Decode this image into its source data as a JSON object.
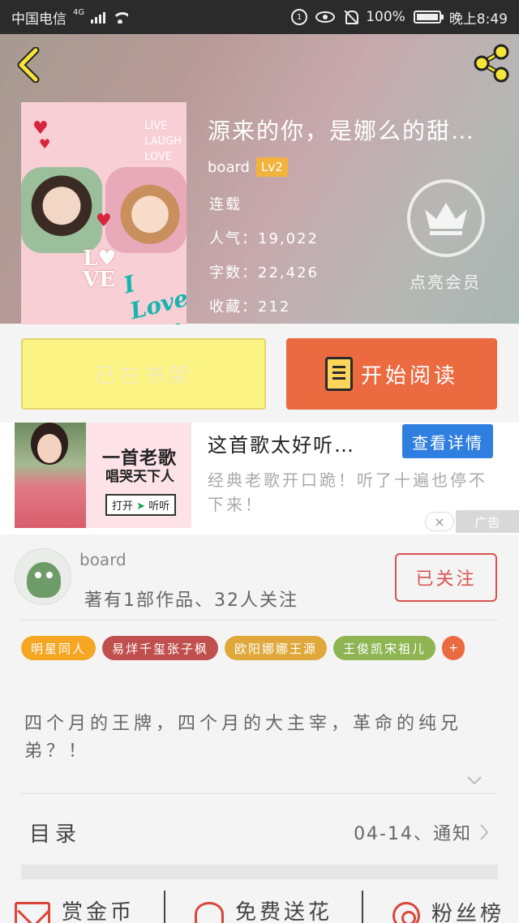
{
  "status_bar": {
    "carrier": "中国电信",
    "network": "4G",
    "do_not_disturb_icon": "1",
    "battery": "100%",
    "time": "晚上8:49"
  },
  "header": {
    "back_icon": "chevron-left-icon",
    "share_icon": "share-icon"
  },
  "book": {
    "title": "源来的你，是娜么的甜…",
    "author": "board",
    "level": "Lv2",
    "status": "连载",
    "popularity": "人气：19,022",
    "word_count": "字数：22,426",
    "favorites": "收藏：212",
    "cover": {
      "live_text": "LIVE\nLAUGH\nLOVE",
      "love_text": "L♥\nVE",
      "i_love_you": "I Love You"
    }
  },
  "vip": {
    "label": "点亮会员",
    "icon": "crown-icon"
  },
  "actions": {
    "shelf_label": "已在书架",
    "read_label": "开始阅读"
  },
  "ad": {
    "image_line1": "一首老歌",
    "image_line2": "唱哭天下人",
    "image_cta_open": "打开",
    "image_cta_listen": "听听",
    "title": "这首歌太好听…",
    "button": "查看详情",
    "description": "经典老歌开口跪！听了十遍也停不下来！",
    "close": "×",
    "tag": "广告"
  },
  "author_card": {
    "name": "board",
    "stats": "著有1部作品、32人关注",
    "follow_label": "已关注"
  },
  "tags": [
    {
      "label": "明星同人",
      "color": "#f5a623"
    },
    {
      "label": "易烊千玺张子枫",
      "color": "#c0504d"
    },
    {
      "label": "欧阳娜娜王源",
      "color": "#e0a83a"
    },
    {
      "label": "王俊凯宋祖儿",
      "color": "#8eb552"
    }
  ],
  "add_tag": "+",
  "intro": "四个月的王牌，四个月的大主宰，革命的纯兄弟？！",
  "toc": {
    "label": "目录",
    "latest": "04-14、通知"
  },
  "bottom": {
    "reward": "赏金币",
    "flowers": "免费送花",
    "fans": "粉丝榜"
  }
}
